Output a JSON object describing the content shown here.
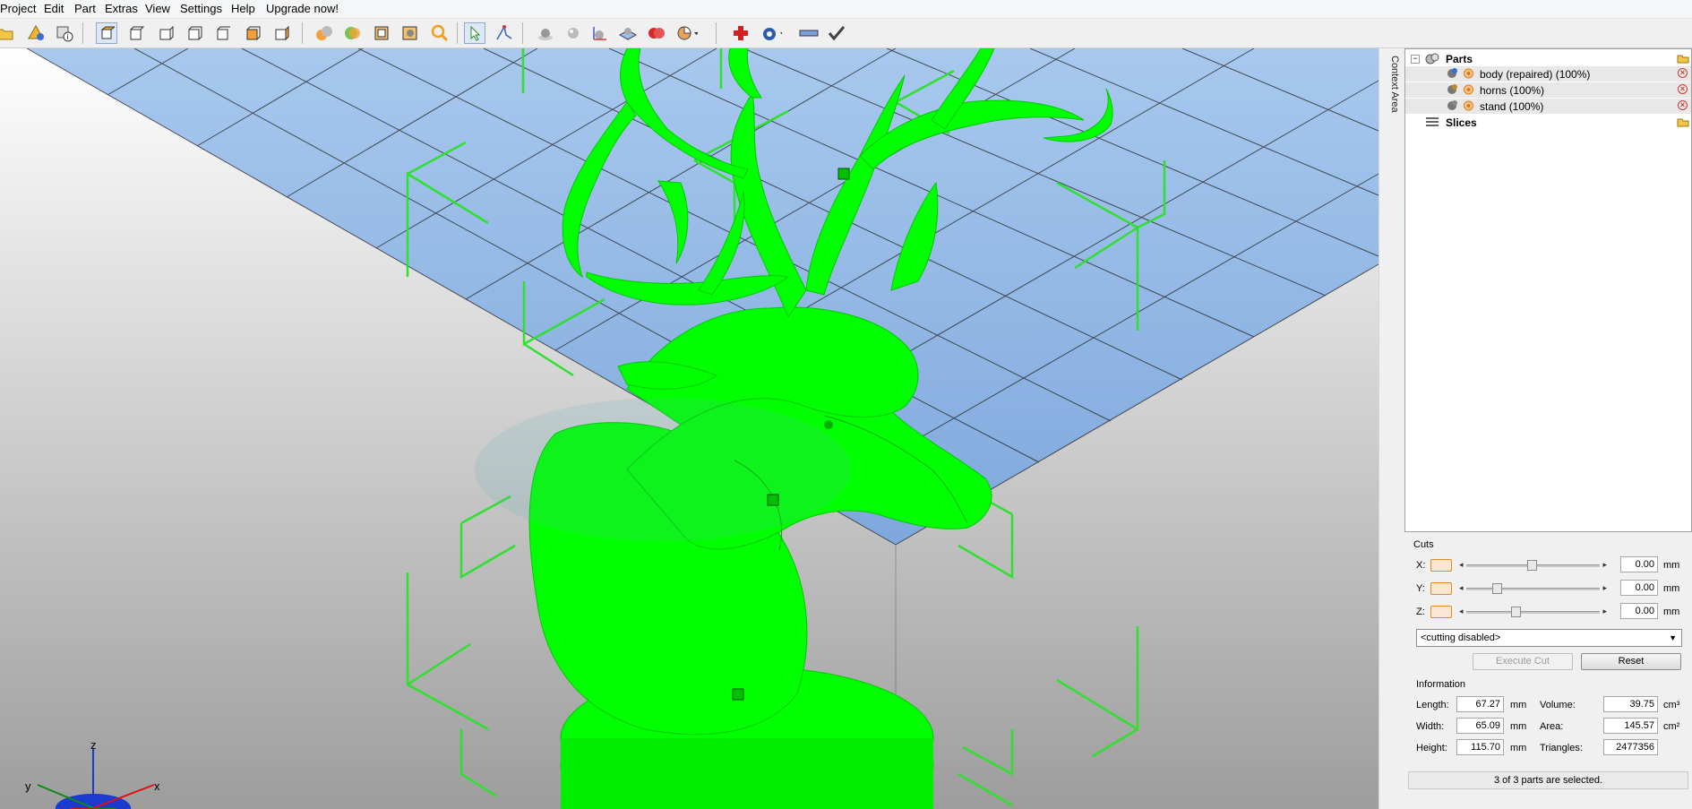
{
  "menu": [
    "Project",
    "Edit",
    "Part",
    "Extras",
    "View",
    "Settings",
    "Help",
    "Upgrade now!"
  ],
  "toolbar": {
    "icons": [
      "open-project-icon",
      "add-part-icon",
      "part-info-icon",
      "view-perspective-icon",
      "view-front-icon",
      "view-back-icon",
      "view-left-icon",
      "view-right-icon",
      "view-top-icon",
      "view-bottom-icon",
      "shading-icon",
      "wireframe-shading-icon",
      "transparency-icon",
      "edge-display-icon",
      "zoom-icon",
      "select-tool-icon",
      "measure-tool-icon",
      "sphere-tool-icon",
      "light-tool-icon",
      "coordinate-tool-icon",
      "platform-icon",
      "colors-icon",
      "pie-view-icon",
      "add-repair-icon",
      "repair-menu-icon",
      "ruler-icon",
      "apply-checkmark-icon"
    ]
  },
  "context_area_label": "Context Area",
  "tree": {
    "root_parts": "Parts",
    "parts": [
      {
        "label": "body (repaired) (100%)"
      },
      {
        "label": "horns (100%)"
      },
      {
        "label": "stand (100%)"
      }
    ],
    "root_slices": "Slices"
  },
  "cuts": {
    "title": "Cuts",
    "axes": [
      {
        "label": "X:",
        "value": "0.00",
        "unit": "mm",
        "thumb_fraction": 0.49
      },
      {
        "label": "Y:",
        "value": "0.00",
        "unit": "mm",
        "thumb_fraction": 0.21
      },
      {
        "label": "Z:",
        "value": "0.00",
        "unit": "mm",
        "thumb_fraction": 0.36
      }
    ],
    "mode": "<cutting disabled>",
    "execute_label": "Execute Cut",
    "reset_label": "Reset"
  },
  "information": {
    "title": "Information",
    "length_label": "Length:",
    "length": "67.27",
    "length_unit": "mm",
    "width_label": "Width:",
    "width": "65.09",
    "width_unit": "mm",
    "height_label": "Height:",
    "height": "115.70",
    "height_unit": "mm",
    "volume_label": "Volume:",
    "volume": "39.75",
    "volume_unit": "cm³",
    "area_label": "Area:",
    "area": "145.57",
    "area_unit": "cm²",
    "triangles_label": "Triangles:",
    "triangles": "2477356"
  },
  "status": "3 of 3 parts are selected.",
  "gizmo": {
    "x": "x",
    "y": "y",
    "z": "z"
  },
  "colors": {
    "model": "#00ff00",
    "plate": "#8fb6e3",
    "selection": "#2fe02f",
    "accent": "#e08a2c"
  }
}
